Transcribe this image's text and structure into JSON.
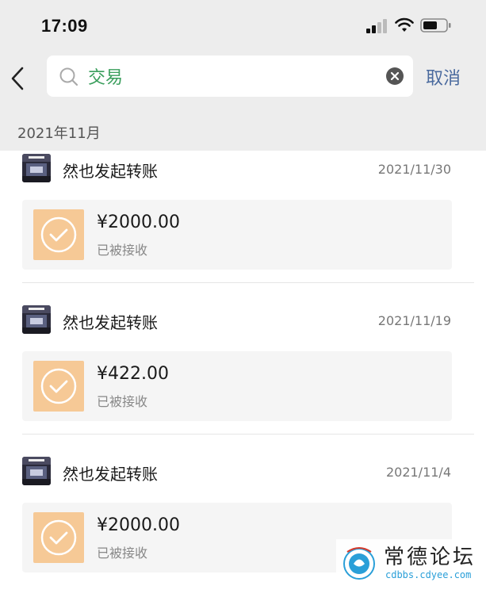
{
  "status_bar": {
    "time": "17:09",
    "icons": [
      "signal-icon",
      "wifi-icon",
      "battery-icon"
    ]
  },
  "search": {
    "query": "交易",
    "cancel_label": "取消",
    "icons": [
      "back-chevron-icon",
      "search-icon",
      "clear-icon"
    ]
  },
  "section": {
    "month_label": "2021年11月"
  },
  "transactions": [
    {
      "title": "然也发起转账",
      "date": "2021/11/30",
      "amount": "¥2000.00",
      "status": "已被接收"
    },
    {
      "title": "然也发起转账",
      "date": "2021/11/19",
      "amount": "¥422.00",
      "status": "已被接收"
    },
    {
      "title": "然也发起转账",
      "date": "2021/11/4",
      "amount": "¥2000.00",
      "status": "已被接收"
    }
  ],
  "watermark": {
    "title": "常德论坛",
    "url": "cdbbs.cdyee.com"
  },
  "colors": {
    "header_bg": "#ededed",
    "query_text": "#3a9e5c",
    "cancel_text": "#4a6a9e",
    "transfer_icon_bg": "#f6c996"
  }
}
